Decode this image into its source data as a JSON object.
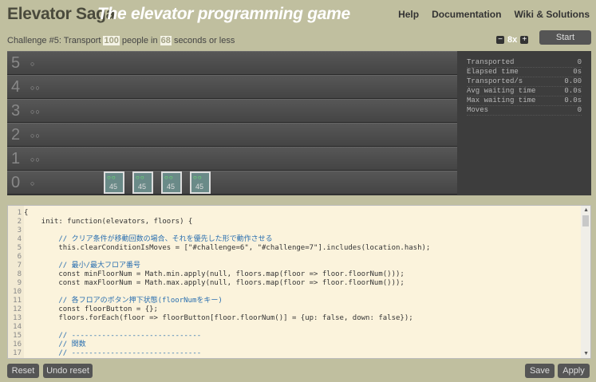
{
  "header": {
    "title": "Elevator Saga",
    "subtitle": "The elevator programming game",
    "nav": [
      "Help",
      "Documentation",
      "Wiki & Solutions"
    ]
  },
  "challenge": {
    "prefix": "Challenge #5: Transport",
    "people": "100",
    "mid": "people in",
    "seconds": "68",
    "suffix": "seconds or less"
  },
  "speed": {
    "minus": "−",
    "value": "8x",
    "plus": "+"
  },
  "start_label": "Start",
  "floors": [
    {
      "num": "5",
      "buttons": "○"
    },
    {
      "num": "4",
      "buttons": "○○"
    },
    {
      "num": "3",
      "buttons": "○○"
    },
    {
      "num": "2",
      "buttons": "○○"
    },
    {
      "num": "1",
      "buttons": "○○"
    },
    {
      "num": "0",
      "buttons": "○"
    }
  ],
  "elevators": [
    {
      "indicator": "○○",
      "value": "45"
    },
    {
      "indicator": "○○",
      "value": "45"
    },
    {
      "indicator": "○○",
      "value": "45"
    },
    {
      "indicator": "○○",
      "value": "45"
    }
  ],
  "stats": [
    {
      "label": "Transported",
      "value": "0"
    },
    {
      "label": "Elapsed time",
      "value": "0s"
    },
    {
      "label": "Transported/s",
      "value": "0.00"
    },
    {
      "label": "Avg waiting time",
      "value": "0.0s"
    },
    {
      "label": "Max waiting time",
      "value": "0.0s"
    },
    {
      "label": "Moves",
      "value": "0"
    }
  ],
  "code_lines": [
    "{",
    "    init: function(elevators, floors) {",
    "",
    "        // クリア条件が移動回数の場合、それを優先した形で動作させる",
    "        this.clearConditionIsMoves = [\"#challenge=6\", \"#challenge=7\"].includes(location.hash);",
    "",
    "        // 最小/最大フロア番号",
    "        const minFloorNum = Math.min.apply(null, floors.map(floor => floor.floorNum()));",
    "        const maxFloorNum = Math.max.apply(null, floors.map(floor => floor.floorNum()));",
    "",
    "        // 各フロアのボタン押下状態(floorNumをキー)",
    "        const floorButton = {};",
    "        floors.forEach(floor => floorButton[floor.floorNum()] = {up: false, down: false});",
    "",
    "        // ------------------------------",
    "        // 関数",
    "        // ------------------------------"
  ],
  "buttons": {
    "reset": "Reset",
    "undo_reset": "Undo reset",
    "save": "Save",
    "apply": "Apply"
  }
}
